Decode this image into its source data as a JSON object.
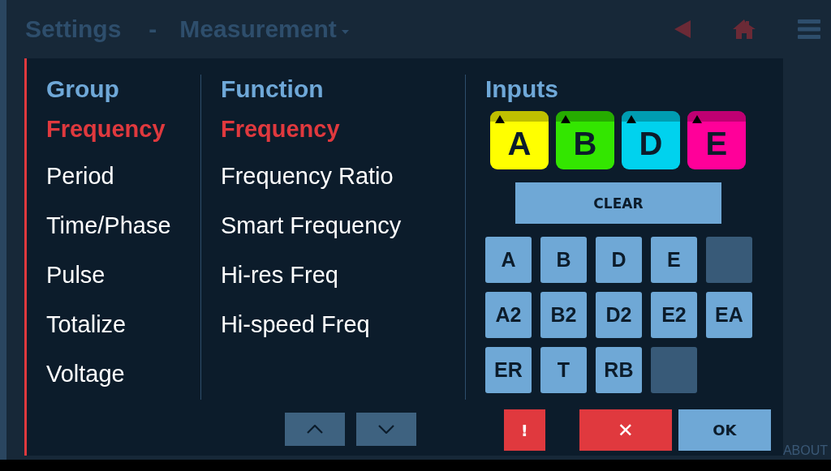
{
  "header": {
    "title": "Settings",
    "separator": "-",
    "menu": "Measurement"
  },
  "footer": {
    "label": "ABOUT"
  },
  "group": {
    "heading": "Group",
    "items": [
      {
        "label": "Frequency",
        "selected": true
      },
      {
        "label": "Period",
        "selected": false
      },
      {
        "label": "Time/Phase",
        "selected": false
      },
      {
        "label": "Pulse",
        "selected": false
      },
      {
        "label": "Totalize",
        "selected": false
      },
      {
        "label": "Voltage",
        "selected": false
      }
    ]
  },
  "function": {
    "heading": "Function",
    "items": [
      {
        "label": "Frequency",
        "selected": true
      },
      {
        "label": "Frequency Ratio",
        "selected": false
      },
      {
        "label": "Smart Frequency",
        "selected": false
      },
      {
        "label": "Hi-res Freq",
        "selected": false
      },
      {
        "label": "Hi-speed Freq",
        "selected": false
      }
    ]
  },
  "inputs": {
    "heading": "Inputs",
    "chips": [
      {
        "label": "A",
        "color": "#ffff00"
      },
      {
        "label": "B",
        "color": "#33e600"
      },
      {
        "label": "D",
        "color": "#00d2ee"
      },
      {
        "label": "E",
        "color": "#ff0099"
      }
    ],
    "clear": "CLEAR",
    "grid": [
      {
        "kind": "button",
        "label": "A"
      },
      {
        "kind": "button",
        "label": "B"
      },
      {
        "kind": "button",
        "label": "D"
      },
      {
        "kind": "button",
        "label": "E"
      },
      {
        "kind": "empty"
      },
      {
        "kind": "button",
        "label": "A2"
      },
      {
        "kind": "button",
        "label": "B2"
      },
      {
        "kind": "button",
        "label": "D2"
      },
      {
        "kind": "button",
        "label": "E2"
      },
      {
        "kind": "button",
        "label": "EA"
      },
      {
        "kind": "button",
        "label": "ER"
      },
      {
        "kind": "button",
        "label": "T"
      },
      {
        "kind": "button",
        "label": "RB"
      },
      {
        "kind": "empty"
      }
    ]
  },
  "actions": {
    "alert": "!",
    "cancel": "✕",
    "ok": "OK"
  }
}
